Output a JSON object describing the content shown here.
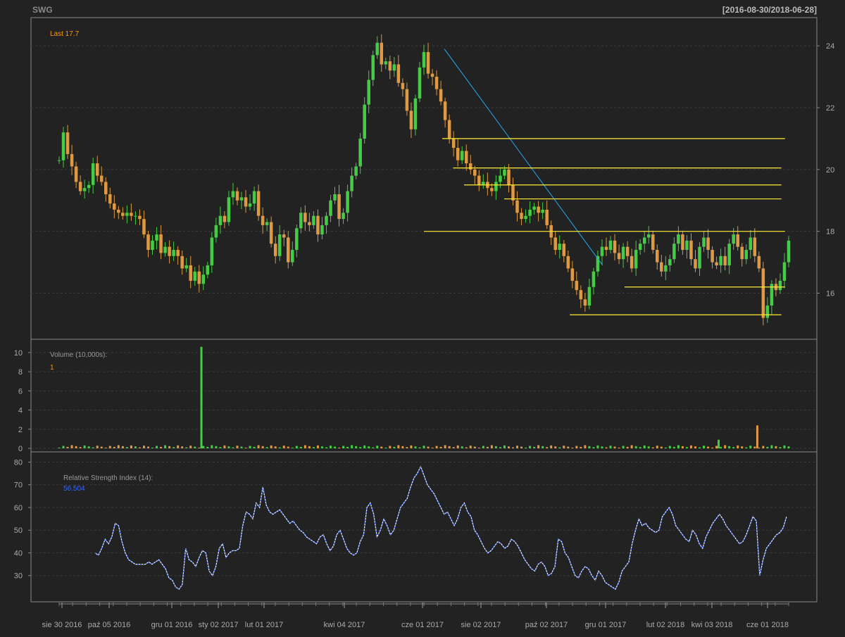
{
  "chart_data": {
    "type": "candlestick",
    "symbol": "SWG",
    "date_range": "[2016-08-30/2018-06-28]",
    "last_label": "Last 17.7",
    "x_tick_labels": [
      "sie 30 2016",
      "paź 05 2016",
      "gru 01 2016",
      "sty 02 2017",
      "lut 01 2017",
      "kwi 04 2017",
      "cze 01 2017",
      "sie 02 2017",
      "paź 02 2017",
      "gru 01 2017",
      "lut 02 2018",
      "kwi 03 2018",
      "cze 01 2018"
    ],
    "price_panel": {
      "ylim": [
        14.6,
        24.8
      ],
      "yticks": [
        "16",
        "18",
        "20",
        "22",
        "24"
      ],
      "close_series": [
        20.3,
        21.2,
        20.5,
        20.1,
        19.6,
        19.3,
        19.4,
        19.5,
        20.2,
        19.8,
        19.6,
        19.2,
        18.9,
        18.7,
        18.6,
        18.5,
        18.6,
        18.5,
        18.5,
        18.4,
        17.9,
        17.4,
        17.7,
        17.9,
        17.3,
        17.5,
        17.2,
        17.4,
        17.2,
        16.8,
        16.9,
        16.4,
        16.7,
        16.3,
        16.6,
        16.9,
        17.8,
        18.2,
        18.5,
        18.3,
        19.1,
        19.3,
        19.0,
        19.1,
        18.8,
        18.9,
        19.3,
        18.5,
        18.2,
        18.3,
        17.6,
        17.2,
        17.9,
        17.8,
        17.0,
        17.4,
        18.1,
        18.6,
        18.3,
        18.2,
        18.5,
        17.9,
        18.2,
        18.5,
        19.0,
        19.2,
        18.4,
        18.6,
        19.3,
        19.8,
        20.1,
        21.0,
        22.1,
        22.9,
        23.7,
        24.1,
        23.4,
        23.5,
        23.2,
        23.4,
        22.8,
        22.6,
        21.9,
        21.3,
        22.3,
        23.3,
        23.8,
        23.1,
        23.0,
        22.6,
        22.2,
        21.6,
        21.0,
        20.7,
        20.3,
        20.6,
        20.2,
        20.0,
        19.8,
        19.5,
        19.6,
        19.4,
        19.3,
        19.6,
        19.8,
        20.0,
        19.5,
        19.0,
        18.6,
        18.4,
        18.5,
        18.7,
        18.8,
        18.6,
        18.7,
        18.2,
        17.8,
        17.4,
        17.6,
        17.2,
        16.8,
        16.4,
        16.1,
        15.8,
        15.6,
        16.2,
        16.7,
        17.2,
        17.5,
        17.4,
        17.7,
        17.3,
        17.1,
        17.5,
        17.2,
        16.8,
        17.4,
        17.6,
        17.8,
        17.9,
        17.4,
        17.0,
        16.7,
        16.9,
        17.1,
        17.6,
        17.9,
        17.4,
        17.7,
        17.1,
        16.8,
        17.5,
        17.8,
        17.4,
        17.0,
        16.9,
        17.2,
        16.9,
        17.6,
        17.9,
        17.5,
        17.1,
        17.4,
        17.8,
        17.2,
        16.8,
        15.2,
        15.6,
        16.3,
        16.1,
        16.4,
        17.0,
        17.7
      ]
    },
    "volume_panel": {
      "title": "Volume (10,000s):",
      "last_value": "1",
      "ylim": [
        0,
        10.8
      ],
      "yticks": [
        "0",
        "2",
        "4",
        "6",
        "8",
        "10"
      ],
      "spikes": [
        {
          "x": 0.195,
          "value": 10.6
        },
        {
          "x": 0.957,
          "value": 2.4
        },
        {
          "x": 0.904,
          "value": 0.9
        }
      ]
    },
    "rsi_panel": {
      "title": "Relative Strength Index (14):",
      "last_value": "56.504",
      "ylim": [
        20,
        82
      ],
      "yticks": [
        "30",
        "40",
        "50",
        "60",
        "70",
        "80"
      ],
      "values": [
        40,
        39,
        42,
        46,
        44,
        47,
        53,
        52,
        45,
        40,
        37,
        36,
        35,
        35,
        35,
        35,
        36,
        35,
        36,
        37,
        35,
        33,
        29,
        28,
        25,
        24,
        26,
        42,
        37,
        36,
        34,
        38,
        41,
        40,
        32,
        30,
        34,
        42,
        44,
        38,
        40,
        41,
        41,
        42,
        52,
        58,
        57,
        55,
        62,
        60,
        69,
        61,
        58,
        57,
        58,
        59,
        57,
        55,
        53,
        54,
        52,
        50,
        49,
        47,
        46,
        45,
        44,
        47,
        48,
        44,
        41,
        43,
        48,
        50,
        46,
        42,
        40,
        39,
        40,
        45,
        48,
        60,
        62,
        57,
        47,
        50,
        55,
        52,
        48,
        50,
        55,
        60,
        62,
        64,
        69,
        73,
        75,
        78,
        74,
        70,
        68,
        66,
        63,
        60,
        57,
        58,
        55,
        52,
        55,
        60,
        62,
        58,
        56,
        50,
        48,
        45,
        42,
        40,
        41,
        43,
        45,
        44,
        42,
        43,
        46,
        45,
        43,
        40,
        37,
        35,
        33,
        32,
        35,
        36,
        34,
        30,
        31,
        34,
        46,
        45,
        40,
        38,
        34,
        30,
        29,
        32,
        34,
        33,
        30,
        28,
        32,
        30,
        27,
        26,
        25,
        24,
        27,
        32,
        34,
        36,
        44,
        50,
        55,
        52,
        53,
        51,
        50,
        49,
        50,
        56,
        58,
        60,
        57,
        52,
        50,
        48,
        46,
        45,
        50,
        48,
        44,
        42,
        47,
        50,
        53,
        55,
        57,
        55,
        52,
        50,
        48,
        46,
        44,
        45,
        48,
        52,
        56,
        54,
        30,
        37,
        42,
        44,
        46,
        48,
        49,
        51,
        56
      ]
    },
    "colors": {
      "background": "#222222",
      "panel_border": "#888888",
      "grid": "#3a3a3a",
      "axis_text": "#aaaaaa",
      "up": "#44cc44",
      "down": "#dd9944",
      "trendline": "#22aaee",
      "support_lines": "#ffee33",
      "rsi_line": "#3366ff",
      "last_label": "#ff9900"
    },
    "trendline": {
      "from": [
        0.528,
        23.9
      ],
      "to": [
        0.745,
        16.9
      ]
    },
    "support_levels": [
      {
        "y": 21.0,
        "x_from": 0.525,
        "x_to": 0.995
      },
      {
        "y": 20.05,
        "x_from": 0.54,
        "x_to": 0.99
      },
      {
        "y": 19.5,
        "x_from": 0.555,
        "x_to": 0.99
      },
      {
        "y": 19.05,
        "x_from": 0.61,
        "x_to": 0.99
      },
      {
        "y": 18.0,
        "x_from": 0.5,
        "x_to": 0.995
      },
      {
        "y": 16.2,
        "x_from": 0.775,
        "x_to": 0.995
      },
      {
        "y": 15.3,
        "x_from": 0.7,
        "x_to": 0.99
      }
    ]
  }
}
